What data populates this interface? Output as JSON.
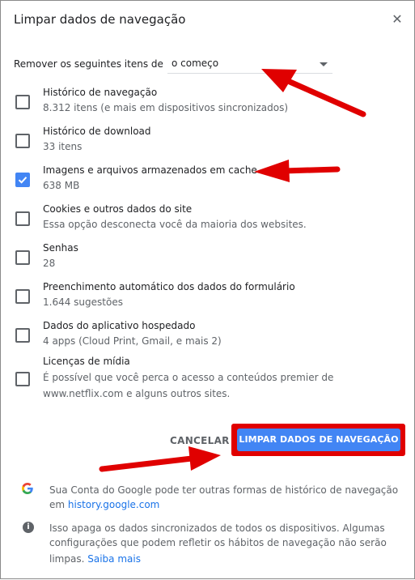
{
  "dialog": {
    "title": "Limpar dados de navegação",
    "close_icon": "close-icon"
  },
  "range": {
    "label": "Remover os seguintes itens de",
    "selected": "o começo"
  },
  "items": [
    {
      "label": "Histórico de navegação",
      "sub": "8.312 itens (e mais em dispositivos sincronizados)",
      "checked": false
    },
    {
      "label": "Histórico de download",
      "sub": "33 itens",
      "checked": false
    },
    {
      "label": "Imagens e arquivos armazenados em cache",
      "sub": "638 MB",
      "checked": true
    },
    {
      "label": "Cookies e outros dados do site",
      "sub": "Essa opção desconecta você da maioria dos websites.",
      "checked": false
    },
    {
      "label": "Senhas",
      "sub": "28",
      "checked": false
    },
    {
      "label": "Preenchimento automático dos dados do formulário",
      "sub": "1.644 sugestões",
      "checked": false
    },
    {
      "label": "Dados do aplicativo hospedado",
      "sub": "4 apps (Cloud Print, Gmail, e mais 2)",
      "checked": false
    },
    {
      "label": "Licenças de mídia",
      "sub": "É possível que você perca o acesso a conteúdos premier de www.netflix.com e alguns outros sites.",
      "checked": false
    }
  ],
  "buttons": {
    "cancel": "CANCELAR",
    "clear": "LIMPAR DADOS DE NAVEGAÇÃO"
  },
  "footer": {
    "google_text": "Sua Conta do Google pode ter outras formas de histórico de navegação",
    "google_text_prefix2": "em",
    "google_link": "history.google.com",
    "info_text_1": "Isso apaga os dados sincronizados de todos os dispositivos. Algumas",
    "info_text_2": "configurações que podem refletir os hábitos de navegação não serão",
    "info_text_3": "limpas.",
    "info_link": "Saiba mais"
  },
  "colors": {
    "accent": "#4285f4",
    "annotation": "#e00000"
  }
}
